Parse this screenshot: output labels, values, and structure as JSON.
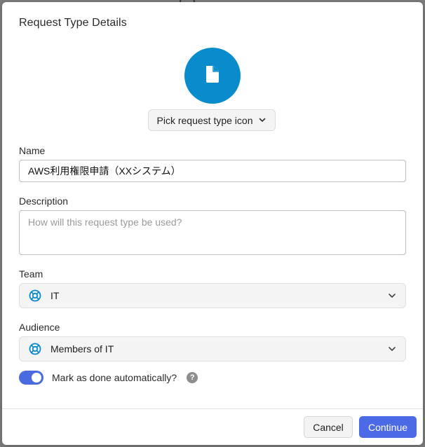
{
  "dialog": {
    "title": "Request Type Details",
    "icon": "document-icon",
    "icon_bg_color": "#0a8ccc",
    "pick_icon_label": "Pick request type icon"
  },
  "fields": {
    "name_label": "Name",
    "name_value": "AWS利用権限申請（XXシステム）",
    "description_label": "Description",
    "description_placeholder": "How will this request type be used?",
    "team_label": "Team",
    "team_value": "IT",
    "team_icon": "lifebuoy-icon",
    "audience_label": "Audience",
    "audience_value": "Members of IT",
    "audience_icon": "lifebuoy-icon"
  },
  "toggle": {
    "label": "Mark as done automatically?",
    "on": true,
    "help_glyph": "?",
    "accent_color": "#4a6ae0"
  },
  "footer": {
    "cancel_label": "Cancel",
    "continue_label": "Continue",
    "primary_color": "#4d6ae6"
  }
}
